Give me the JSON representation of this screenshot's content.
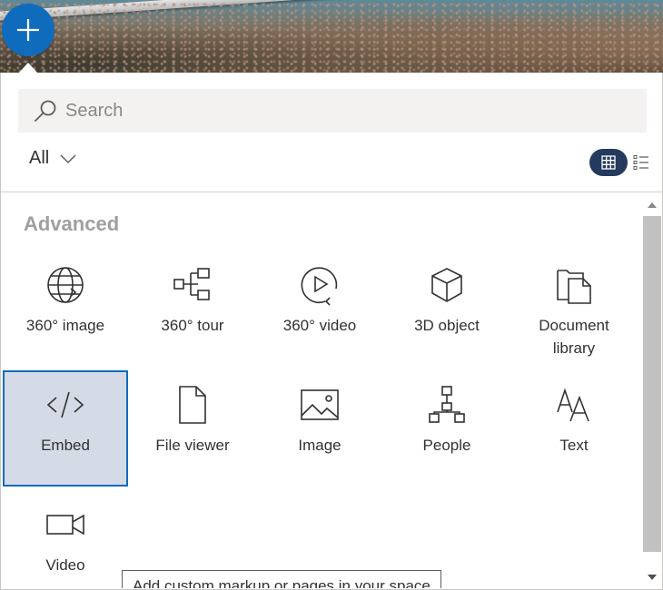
{
  "search": {
    "placeholder": "Search"
  },
  "filter": {
    "value": "All"
  },
  "section": {
    "title": "Advanced"
  },
  "tiles": [
    {
      "label": "360° image",
      "icon": "globe-icon"
    },
    {
      "label": "360° tour",
      "icon": "tour-flow-icon"
    },
    {
      "label": "360° video",
      "icon": "video-360-icon"
    },
    {
      "label": "3D object",
      "icon": "cube-icon"
    },
    {
      "label": "Document library",
      "icon": "document-library-icon"
    },
    {
      "label": "Embed",
      "icon": "code-icon"
    },
    {
      "label": "File viewer",
      "icon": "file-icon"
    },
    {
      "label": "Image",
      "icon": "image-icon"
    },
    {
      "label": "People",
      "icon": "org-chart-icon"
    },
    {
      "label": "Text",
      "icon": "text-icon"
    },
    {
      "label": "Video",
      "icon": "video-camera-icon"
    }
  ],
  "tooltip": {
    "text": "Add custom markup or pages in your space"
  },
  "colors": {
    "accent": "#0f6cbd",
    "selected_bg": "#d4dbe6",
    "toggle_active": "#243a5e"
  }
}
